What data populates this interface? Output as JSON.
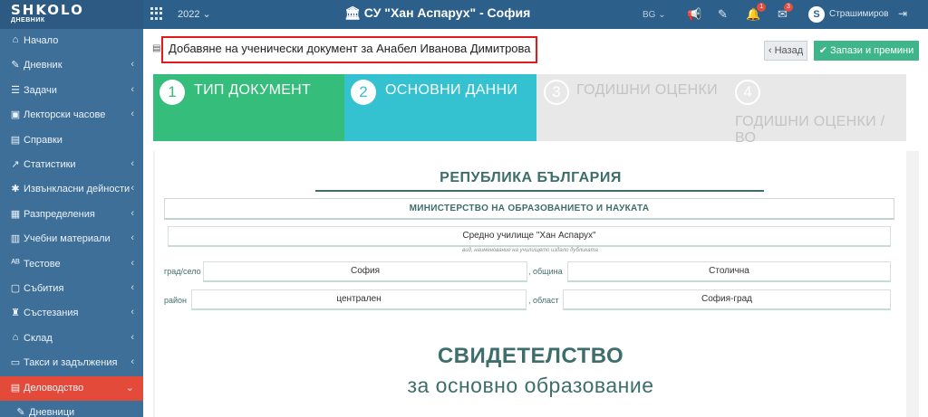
{
  "app": {
    "logo": "SHKOLO",
    "logo_sub": "ДНЕВНИК",
    "year": "2022",
    "school": "СУ \"Хан Аспарух\" - София",
    "lang": "BG"
  },
  "user": {
    "avatar": "S",
    "name": "Страшимиров"
  },
  "notifications": {
    "tasks": "1",
    "messages": "3"
  },
  "icons": {
    "apps": "grid-icon",
    "bell": "megaphone-icon",
    "edit": "edit-icon",
    "messages": "envelope-icon",
    "logout": "logout-icon"
  },
  "sidebar": {
    "items": [
      {
        "icon": "home-icon",
        "glyph": "⌂",
        "label": "Начало",
        "chevron": false
      },
      {
        "icon": "book-icon",
        "glyph": "✎",
        "label": "Дневник",
        "chevron": true
      },
      {
        "icon": "tasks-icon",
        "glyph": "☰",
        "label": "Задачи",
        "chevron": true
      },
      {
        "icon": "briefcase-icon",
        "glyph": "▣",
        "label": "Лекторски часове",
        "chevron": true
      },
      {
        "icon": "document-icon",
        "glyph": "▤",
        "label": "Справки",
        "chevron": false
      },
      {
        "icon": "chart-icon",
        "glyph": "↗",
        "label": "Статистики",
        "chevron": true
      },
      {
        "icon": "running-icon",
        "glyph": "✱",
        "label": "Извънкласни дейности",
        "chevron": true
      },
      {
        "icon": "list-icon",
        "glyph": "▦",
        "label": "Разпределения",
        "chevron": true
      },
      {
        "icon": "books-icon",
        "glyph": "▥",
        "label": "Учебни материали",
        "chevron": true
      },
      {
        "icon": "test-icon",
        "glyph": "ᴬᴮ",
        "label": "Тестове",
        "chevron": true
      },
      {
        "icon": "calendar-icon",
        "glyph": "▢",
        "label": "Събития",
        "chevron": true
      },
      {
        "icon": "trophy-icon",
        "glyph": "♜",
        "label": "Състезания",
        "chevron": true
      },
      {
        "icon": "warehouse-icon",
        "glyph": "⌂",
        "label": "Склад",
        "chevron": true
      },
      {
        "icon": "wallet-icon",
        "glyph": "▭",
        "label": "Такси и задължения",
        "chevron": true
      },
      {
        "icon": "records-icon",
        "glyph": "▤",
        "label": "Деловодство",
        "chevron": true,
        "active": true
      },
      {
        "icon": "journal-icon",
        "glyph": "✎",
        "label": "Дневници",
        "chevron": false,
        "sub": true
      }
    ]
  },
  "page": {
    "title": "Добавяне на ученически документ за Анабел Иванова Димитрова",
    "back_label": "Назад",
    "save_label": "Запази и премини"
  },
  "wizard": {
    "steps": [
      {
        "num": "1",
        "label": "ТИП ДОКУМЕНТ",
        "state": "done"
      },
      {
        "num": "2",
        "label": "ОСНОВНИ ДАННИ",
        "state": "current"
      },
      {
        "num": "3",
        "label": "ГОДИШНИ ОЦЕНКИ",
        "state": "pending"
      },
      {
        "num": "4",
        "label": "ГОДИШНИ ОЦЕНКИ / ВО",
        "state": "pending"
      }
    ]
  },
  "form": {
    "republic": "РЕПУБЛИКА БЪЛГАРИЯ",
    "ministry": "МИНИСТЕРСТВО НА ОБРАЗОВАНИЕТО И НАУКАТА",
    "school_name": "Средно училище \"Хан Аспарух\"",
    "school_hint": "вид, наименование на училището издало дубликата",
    "city_label": "град/село",
    "city": "София",
    "municipality_label": ", община",
    "municipality": "Столична",
    "district_label": "район",
    "district": "централен",
    "region_label": ", област",
    "region": "София-град",
    "certificate_title": "СВИДЕТЕЛСТВО",
    "certificate_subtitle": "за основно образование"
  },
  "colors": {
    "topbar": "#2c5f8a",
    "sidebar": "#3d6f99",
    "active": "#e34a3a",
    "step1": "#35bd7b",
    "step2": "#34c2d1",
    "save": "#3fb58a",
    "teal_text": "#3e6e6b"
  }
}
